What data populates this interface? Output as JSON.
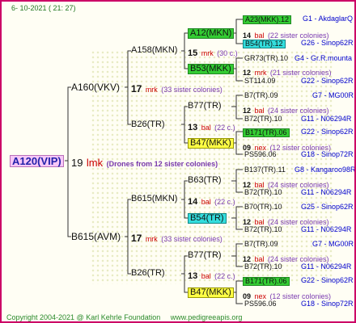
{
  "header": {
    "date": "6- 10-2021 ( 21: 27)"
  },
  "footer": {
    "copyright": "Copyright 2004-2021 @ Karl Kehrle Foundation",
    "site": "www.pedigreeapis.org"
  },
  "root": {
    "name": "A120(VIP)",
    "drone_num": "19",
    "drone_code": "lmk",
    "drone_desc": "(Drones from 12 sister colonies)"
  },
  "gen1": {
    "upper": {
      "name": "A160(VKV)",
      "num": "17",
      "code": "mrk",
      "desc": "(33 sister colonies)"
    },
    "lower": {
      "name": "B615(AVM)",
      "num": "17",
      "code": "mrk",
      "desc": "(33 sister colonies)"
    }
  },
  "gen2": {
    "a_upper": {
      "name": "A158(MKN)",
      "num": "15",
      "code": "mrk",
      "desc": "(30 c.)"
    },
    "a_lower": {
      "name": "B26(TR)",
      "num": "13",
      "code": "bal",
      "desc": "(22 c.)"
    },
    "b_upper": {
      "name": "B615(MKN)",
      "num": "14",
      "code": "bal",
      "desc": "(22 c.)"
    },
    "b_lower": {
      "name": "B26(TR)",
      "num": "13",
      "code": "bal",
      "desc": "(22 c.)"
    }
  },
  "gen3": {
    "r1": {
      "name": "A12(MKN)",
      "num": "14",
      "code": "bal",
      "desc": "(22 sister colonies)"
    },
    "r2": {
      "name": "B53(MKK)",
      "num": "12",
      "code": "mrk",
      "desc": "(21 sister colonies)"
    },
    "r3": {
      "name": "B77(TR)",
      "num": "12",
      "code": "bal",
      "desc": "(24 sister colonies)"
    },
    "r4": {
      "name": "B47(MKK)",
      "num": "09",
      "code": "nex",
      "desc": "(12 sister colonies)"
    },
    "r5": {
      "name": "B63(TR)",
      "num": "12",
      "code": "bal",
      "desc": "(24 sister colonies)"
    },
    "r6": {
      "name": "B54(TR)",
      "num": "12",
      "code": "bal",
      "desc": "(24 sister colonies)"
    },
    "r7": {
      "name": "B77(TR)",
      "num": "12",
      "code": "bal",
      "desc": "(24 sister colonies)"
    },
    "r8": {
      "name": "B47(MKK)",
      "num": "09",
      "code": "nex",
      "desc": "(12 sister colonies)"
    }
  },
  "gen4": {
    "q1a": {
      "name": "A23(MKK).12",
      "tail": "G1 - AkdaglarQ"
    },
    "q1b": {
      "name": "B54(TR).12",
      "tail": "G26 - Sinop62R"
    },
    "q2a": {
      "name": "GR73(TR).10",
      "tail": "G4 - Gr.R.mounta"
    },
    "q2b": {
      "name": "ST114.09",
      "tail": "G22 - Sinop62R"
    },
    "q3a": {
      "name": "B7(TR).09",
      "tail": "G7 - MG00R"
    },
    "q3b": {
      "name": "B72(TR).10",
      "tail": "G11 - N06294R"
    },
    "q4a": {
      "name": "B171(TR).06",
      "tail": "G22 - Sinop62R"
    },
    "q4b": {
      "name": "PS596.06",
      "tail": "G18 - Sinop72R"
    },
    "q5a": {
      "name": "B137(TR).11",
      "tail": "G8 - Kangaroo98R"
    },
    "q5b": {
      "name": "B72(TR).10",
      "tail": "G11 - N06294R"
    },
    "q6a": {
      "name": "B70(TR).10",
      "tail": "G25 - Sinop62R"
    },
    "q6b": {
      "name": "B72(TR).10",
      "tail": "G11 - N06294R"
    },
    "q7a": {
      "name": "B7(TR).09",
      "tail": "G7 - MG00R"
    },
    "q7b": {
      "name": "B72(TR).10",
      "tail": "G11 - N06294R"
    },
    "q8a": {
      "name": "B171(TR).06",
      "tail": "G22 - Sinop62R"
    },
    "q8b": {
      "name": "PS596.06",
      "tail": "G18 - Sinop72R"
    }
  }
}
